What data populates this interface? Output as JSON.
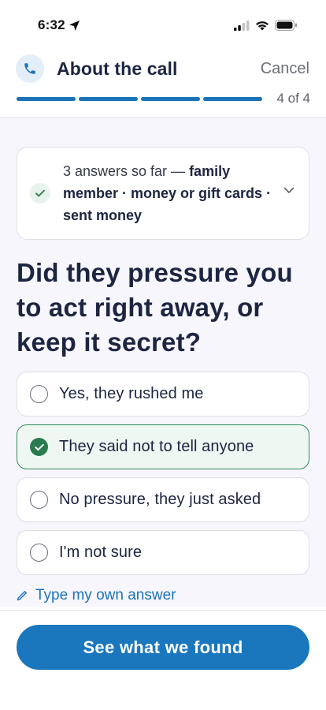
{
  "status_bar": {
    "time": "6:32"
  },
  "header": {
    "title": "About the call",
    "cancel_label": "Cancel",
    "icon": "phone-icon",
    "accent": "#1a73b9"
  },
  "progress": {
    "label": "4 of 4",
    "current_step": 4,
    "total_steps": 4
  },
  "summary": {
    "prefix": "3 answers so far — ",
    "answer_1": "family member",
    "sep_1": " · ",
    "answer_2": "money or gift cards",
    "sep_2": " · ",
    "answer_3": "sent money"
  },
  "question": {
    "text": "Did they pressure you to act right away, or keep it secret?"
  },
  "options": [
    {
      "label": "Yes, they rushed me",
      "selected": false
    },
    {
      "label": "They said not to tell anyone",
      "selected": true
    },
    {
      "label": "No pressure, they just asked",
      "selected": false
    },
    {
      "label": "I'm not sure",
      "selected": false
    }
  ],
  "own_answer": {
    "label": "Type my own answer"
  },
  "cta": {
    "label": "See what we found",
    "color": "#1a77bd"
  },
  "colors": {
    "selected_border": "#2f8a5a",
    "selected_bg": "#eef7f1",
    "page_bg": "#f8f6fd"
  }
}
